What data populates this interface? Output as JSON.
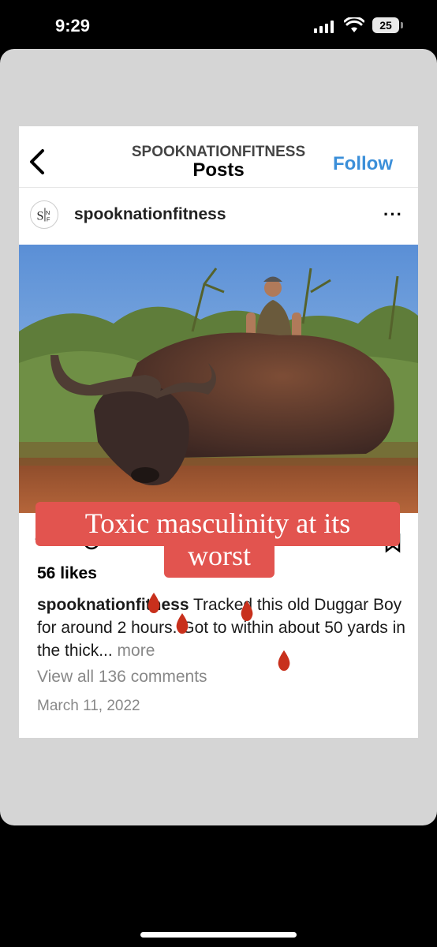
{
  "status": {
    "time": "9:29",
    "battery": "25"
  },
  "header": {
    "username": "SPOOKNATIONFITNESS",
    "title": "Posts",
    "follow_label": "Follow"
  },
  "post": {
    "username": "spooknationfitness",
    "avatar_text": "SNF",
    "likes": "56 likes",
    "caption_user": "spooknationfitness",
    "caption_text": " Tracked this old Duggar Boy for around 2 hours. Got to within about 50 yards in the thick...",
    "caption_more": " more",
    "comments_label": "View all 136 comments",
    "date": "March 11, 2022"
  },
  "overlay": {
    "line1": "Toxic masculinity at its",
    "line2": "worst"
  },
  "icons": [
    "back-chevron-icon",
    "more-options-icon",
    "signal-icon",
    "wifi-icon",
    "blood-drop-icon"
  ]
}
